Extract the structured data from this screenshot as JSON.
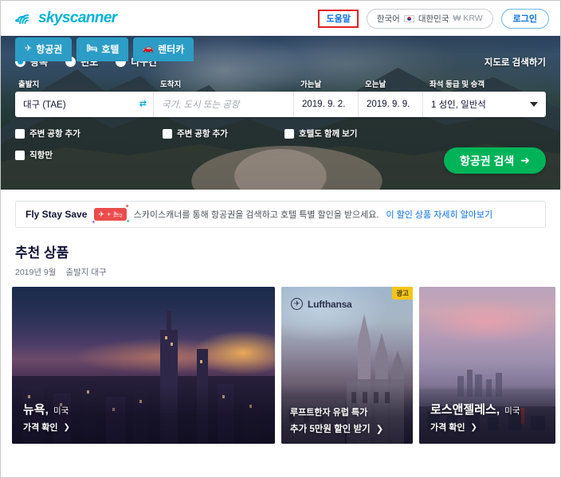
{
  "header": {
    "brand": "skyscanner",
    "help_label": "도움말",
    "locale": {
      "language": "한국어",
      "country": "대한민국",
      "currency": "₩ KRW"
    },
    "login_label": "로그인",
    "accent_color": "#00b2d6",
    "highlight_color": "#e02020"
  },
  "tabs": [
    {
      "label": "항공권",
      "icon": "airplane-icon",
      "active": true
    },
    {
      "label": "호텔",
      "icon": "bed-icon",
      "active": false
    },
    {
      "label": "렌터카",
      "icon": "car-icon",
      "active": false
    }
  ],
  "search": {
    "trip_types": [
      {
        "label": "왕복",
        "selected": true
      },
      {
        "label": "편도",
        "selected": false
      },
      {
        "label": "다구간",
        "selected": false
      }
    ],
    "map_link": "지도로 검색하기",
    "fields": {
      "origin": {
        "label": "출발지",
        "value": "대구 (TAE)"
      },
      "destination": {
        "label": "도착지",
        "value": "",
        "placeholder": "국가, 도시 또는 공항"
      },
      "depart": {
        "label": "가는날",
        "value": "2019. 9. 2."
      },
      "return": {
        "label": "오는날",
        "value": "2019. 9. 9."
      },
      "passengers": {
        "label": "좌석 등급 및 승객",
        "value": "1 성인, 일반석"
      }
    },
    "checkboxes": [
      {
        "label": "주변 공항 추가",
        "checked": false
      },
      {
        "label": "주변 공항 추가",
        "checked": false
      },
      {
        "label": "호텔도 함께 보기",
        "checked": false
      },
      {
        "label": "직항만",
        "checked": false
      }
    ],
    "submit_label": "항공권 검색",
    "submit_color": "#00b359"
  },
  "promo": {
    "title": "Fly Stay Save",
    "badge_icons": "airplane-plus-bed-icon",
    "text": "스카이스캐너를 통해 항공권을 검색하고 호텔 특별 할인을 받으세요.",
    "link": "이 할인 상품 자세히 알아보기",
    "badge_color": "#eb4c4c",
    "link_color": "#0770e3"
  },
  "recommend": {
    "title": "추천 상품",
    "subtitle_month": "2019년 9월",
    "subtitle_origin": "출발지 대구",
    "cards": [
      {
        "type": "destination",
        "city": "뉴욕",
        "country": "미국",
        "cta": "가격 확인",
        "image": "new-york-skyline-sunset"
      },
      {
        "type": "ad",
        "ad_label": "광고",
        "advertiser": "Lufthansa",
        "line1": "루프트한자 유럽 특가",
        "line2": "추가 5만원 할인 받기",
        "image": "european-cathedral"
      },
      {
        "type": "destination",
        "city": "로스앤젤레스",
        "country": "미국",
        "cta": "가격 확인",
        "image": "los-angeles-skyline-dusk"
      }
    ]
  }
}
